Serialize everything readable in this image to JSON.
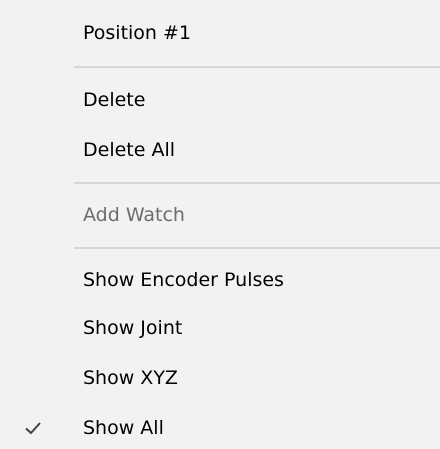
{
  "menu": {
    "items": [
      {
        "label": "Position #1",
        "enabled": true,
        "checked": false
      },
      {
        "label": "Delete",
        "enabled": true,
        "checked": false
      },
      {
        "label": "Delete All",
        "enabled": true,
        "checked": false
      },
      {
        "label": "Add Watch",
        "enabled": false,
        "checked": false
      },
      {
        "label": "Show Encoder Pulses",
        "enabled": true,
        "checked": false
      },
      {
        "label": "Show Joint",
        "enabled": true,
        "checked": false
      },
      {
        "label": "Show XYZ",
        "enabled": true,
        "checked": false
      },
      {
        "label": "Show All",
        "enabled": true,
        "checked": true
      }
    ],
    "icons": {
      "check": "checkmark-icon"
    },
    "colors": {
      "background": "#f2f2f2",
      "text": "#000000",
      "disabled_text": "#6d6d6d",
      "separator": "#d7d7d7",
      "check": "#404040"
    }
  }
}
